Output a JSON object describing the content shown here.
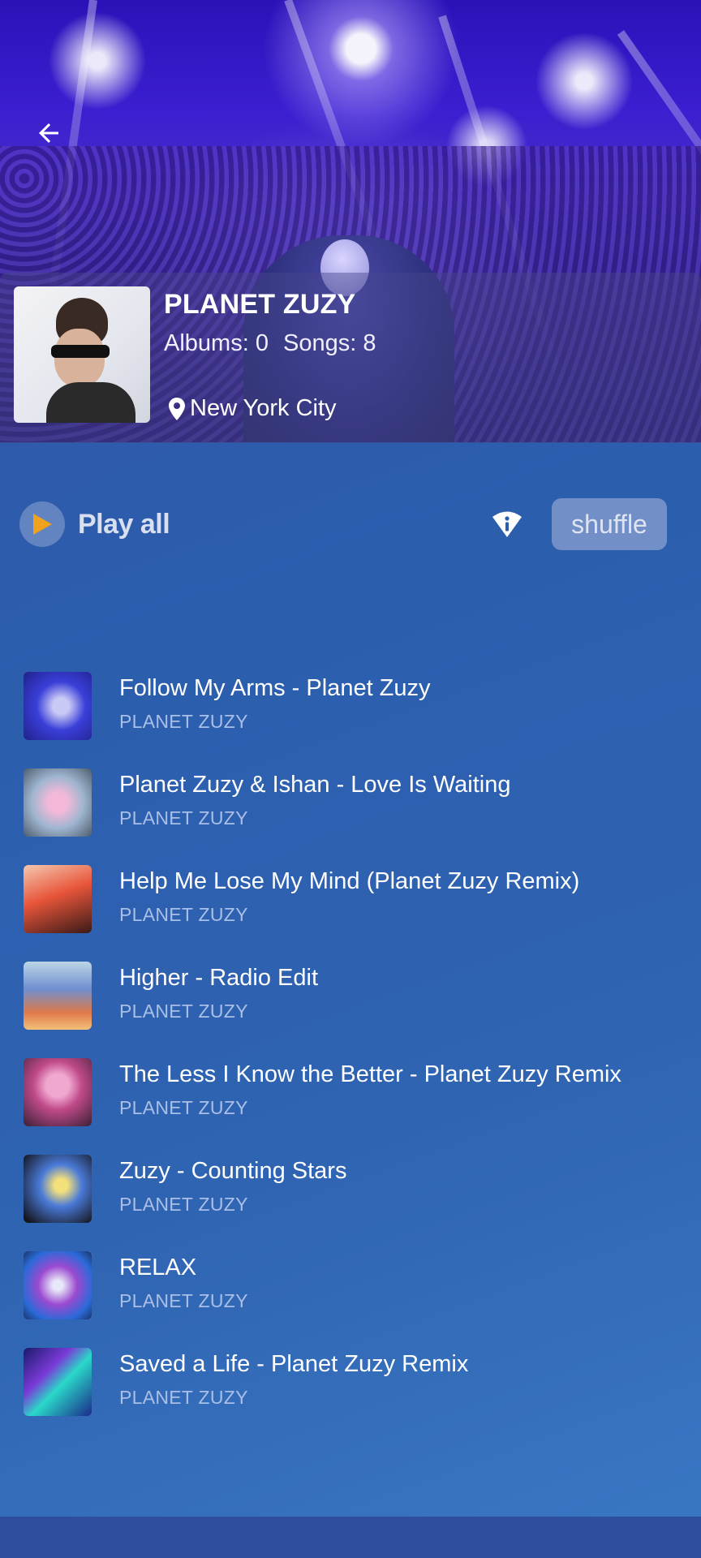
{
  "header": {
    "artist_name": "PLANET ZUZY",
    "albums_text": "Albums: 0",
    "songs_text": "Songs: 8",
    "location": "New York City"
  },
  "icons": {
    "back": "back-arrow-icon",
    "location": "location-pin-icon",
    "play": "play-icon",
    "info": "info-icon"
  },
  "controls": {
    "play_all_label": "Play all",
    "shuffle_label": "shuffle"
  },
  "colors": {
    "play_triangle": "#f0a21e",
    "subtitle": "#a9bfe8",
    "background_top": "#3455a8",
    "background_bottom": "#3a78c4"
  },
  "songs": [
    {
      "title": "Follow My Arms - Planet Zuzy",
      "artist": "PLANET ZUZY"
    },
    {
      "title": "Planet Zuzy & Ishan - Love Is Waiting",
      "artist": "PLANET ZUZY"
    },
    {
      "title": "Help Me Lose My Mind (Planet Zuzy Remix)",
      "artist": "PLANET ZUZY"
    },
    {
      "title": "Higher - Radio Edit",
      "artist": "PLANET ZUZY"
    },
    {
      "title": "The Less I Know the Better - Planet Zuzy Remix",
      "artist": "PLANET ZUZY"
    },
    {
      "title": "Zuzy - Counting Stars",
      "artist": "PLANET ZUZY"
    },
    {
      "title": "RELAX",
      "artist": "PLANET ZUZY"
    },
    {
      "title": "Saved a Life - Planet Zuzy Remix",
      "artist": "PLANET ZUZY"
    }
  ]
}
